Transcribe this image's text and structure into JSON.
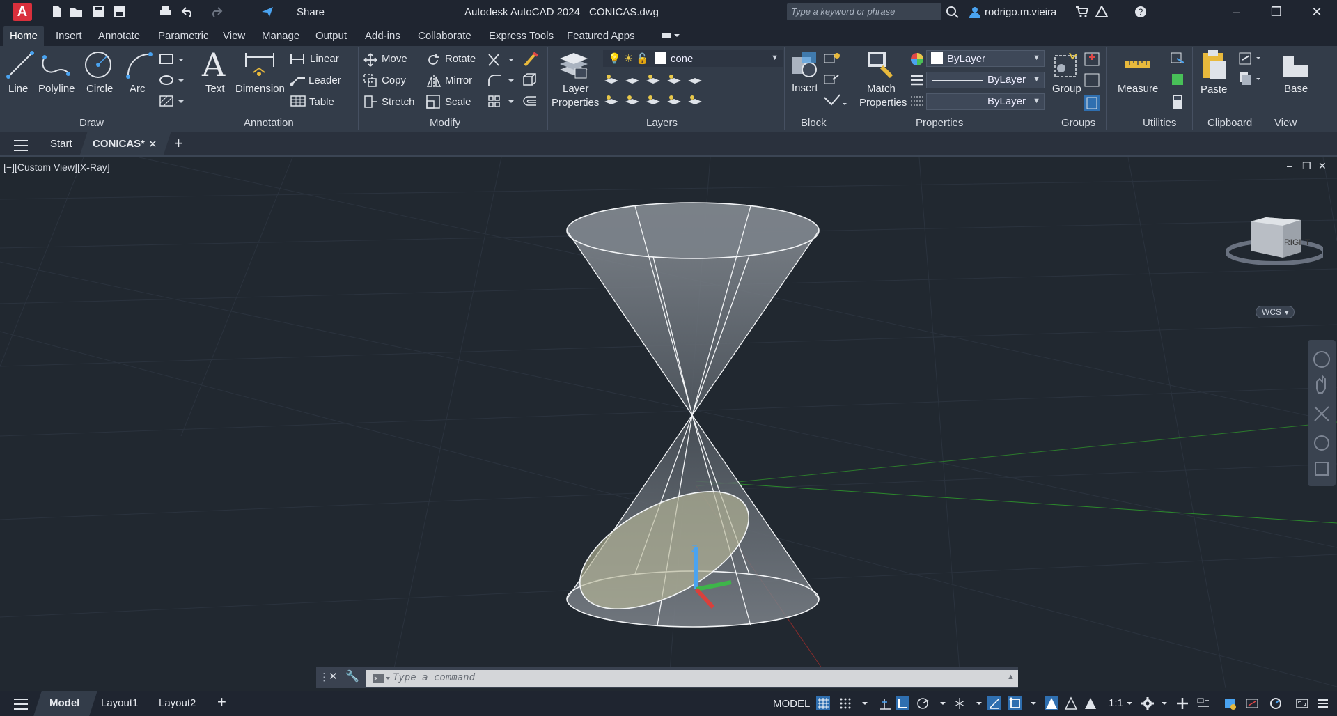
{
  "titlebar": {
    "app_title": "Autodesk AutoCAD 2024",
    "file_title": "CONICAS.dwg",
    "share_label": "Share",
    "search_placeholder": "Type a keyword or phrase",
    "user": "rodrigo.m.vieira"
  },
  "ribbon_tabs": [
    "Home",
    "Insert",
    "Annotate",
    "Parametric",
    "View",
    "Manage",
    "Output",
    "Add-ins",
    "Collaborate",
    "Express Tools",
    "Featured Apps"
  ],
  "ribbon": {
    "draw": {
      "title": "Draw",
      "line": "Line",
      "polyline": "Polyline",
      "circle": "Circle",
      "arc": "Arc"
    },
    "annotation": {
      "title": "Annotation",
      "text": "Text",
      "dimension": "Dimension",
      "linear": "Linear",
      "leader": "Leader",
      "table": "Table"
    },
    "modify": {
      "title": "Modify",
      "move": "Move",
      "rotate": "Rotate",
      "copy": "Copy",
      "mirror": "Mirror",
      "stretch": "Stretch",
      "scale": "Scale"
    },
    "layers": {
      "title": "Layers",
      "layer_properties_1": "Layer",
      "layer_properties_2": "Properties",
      "current_layer": "cone"
    },
    "block": {
      "title": "Block",
      "insert": "Insert"
    },
    "properties": {
      "title": "Properties",
      "match_1": "Match",
      "match_2": "Properties",
      "color": "ByLayer",
      "linetype": "ByLayer",
      "lineweight": "ByLayer"
    },
    "groups": {
      "title": "Groups",
      "group": "Group"
    },
    "utilities": {
      "title": "Utilities",
      "measure": "Measure"
    },
    "clipboard": {
      "title": "Clipboard",
      "paste": "Paste"
    },
    "view": {
      "title": "View",
      "base": "Base"
    }
  },
  "file_tabs": {
    "start": "Start",
    "current": "CONICAS*"
  },
  "viewport": {
    "label": "[−][Custom View][X-Ray]",
    "viewcube_face": "RIGHT",
    "wcs": "WCS",
    "axis_z": "Z"
  },
  "command": {
    "placeholder": "Type a command"
  },
  "status": {
    "layouts": [
      "Model",
      "Layout1",
      "Layout2"
    ],
    "model_label": "MODEL",
    "scale": "1:1"
  }
}
